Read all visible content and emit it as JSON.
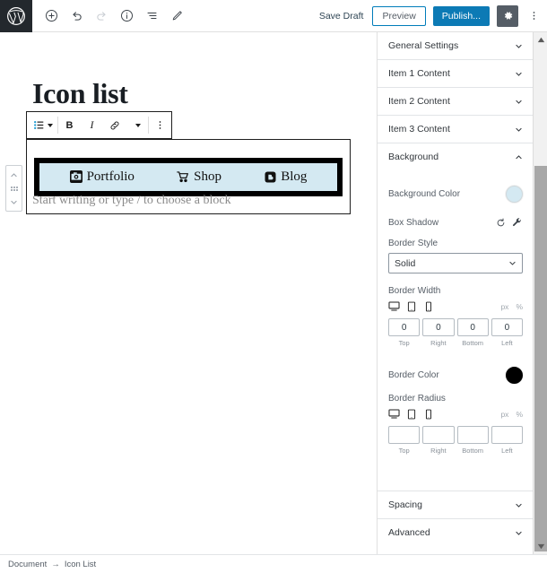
{
  "topbar": {
    "logo_icon": "wordpress-logo-icon",
    "tools": [
      {
        "name": "add-block-button",
        "icon": "plus-circle-icon",
        "disabled": false
      },
      {
        "name": "undo-button",
        "icon": "undo-arrow-icon",
        "disabled": false
      },
      {
        "name": "redo-button",
        "icon": "redo-arrow-icon",
        "disabled": true
      },
      {
        "name": "details-button",
        "icon": "info-circle-icon",
        "disabled": false
      },
      {
        "name": "list-view-button",
        "icon": "list-view-icon",
        "disabled": false
      },
      {
        "name": "edit-mode-button",
        "icon": "pencil-icon",
        "disabled": false
      }
    ],
    "save_draft_label": "Save Draft",
    "preview_label": "Preview",
    "publish_label": "Publish...",
    "settings_icon": "gear-icon",
    "more_menu_icon": "vertical-ellipsis-icon"
  },
  "editor": {
    "post_title": "Icon list",
    "paragraph_placeholder": "Start writing or type / to choose a block",
    "block_toolbar": {
      "block_type_icon": "list-block-icon",
      "bold_label": "B",
      "italic_label": "I",
      "link_icon": "link-icon",
      "more_rich_text_icon": "chevron-down-icon",
      "options_icon": "vertical-ellipsis-icon"
    },
    "block_mover": {
      "up_icon": "chevron-up-icon",
      "drag_icon": "drag-handle-icon",
      "down_icon": "chevron-down-icon"
    },
    "icon_list": {
      "background_color": "#d4e9f2",
      "border_color": "#000000",
      "items": [
        {
          "label": "Portfolio",
          "icon": "camera-icon"
        },
        {
          "label": "Shop",
          "icon": "shopping-cart-icon"
        },
        {
          "label": "Blog",
          "icon": "blogger-b-icon"
        }
      ]
    }
  },
  "sidebar": {
    "panels": [
      {
        "label": "General Settings",
        "expanded": false
      },
      {
        "label": "Item 1 Content",
        "expanded": false
      },
      {
        "label": "Item 2 Content",
        "expanded": false
      },
      {
        "label": "Item 3 Content",
        "expanded": false
      },
      {
        "label": "Background",
        "expanded": true
      }
    ],
    "bottom_panels": [
      {
        "label": "Spacing",
        "expanded": false
      },
      {
        "label": "Advanced",
        "expanded": false
      }
    ],
    "background": {
      "background_color_label": "Background Color",
      "background_color_value": "#d4e9f2",
      "box_shadow_label": "Box Shadow",
      "box_shadow_reset_icon": "reset-arrow-icon",
      "box_shadow_edit_icon": "wrench-icon",
      "border_style_label": "Border Style",
      "border_style_value": "Solid",
      "border_width_label": "Border Width",
      "border_width_units": [
        "px",
        "%"
      ],
      "border_width_values": [
        "0",
        "0",
        "0",
        "0"
      ],
      "border_color_label": "Border Color",
      "border_color_value": "#000000",
      "border_radius_label": "Border Radius",
      "border_radius_units": [
        "px",
        "%"
      ],
      "border_radius_values": [
        "",
        "",
        "",
        ""
      ],
      "side_labels": [
        "Top",
        "Right",
        "Bottom",
        "Left"
      ],
      "device_icons": [
        "desktop-icon",
        "tablet-icon",
        "mobile-icon"
      ]
    },
    "scrollbar": {
      "up_icon": "scroll-up-arrow-icon",
      "down_icon": "scroll-down-arrow-icon"
    }
  },
  "statusbar": {
    "breadcrumb": [
      "Document",
      "Icon List"
    ],
    "separator": "→"
  }
}
